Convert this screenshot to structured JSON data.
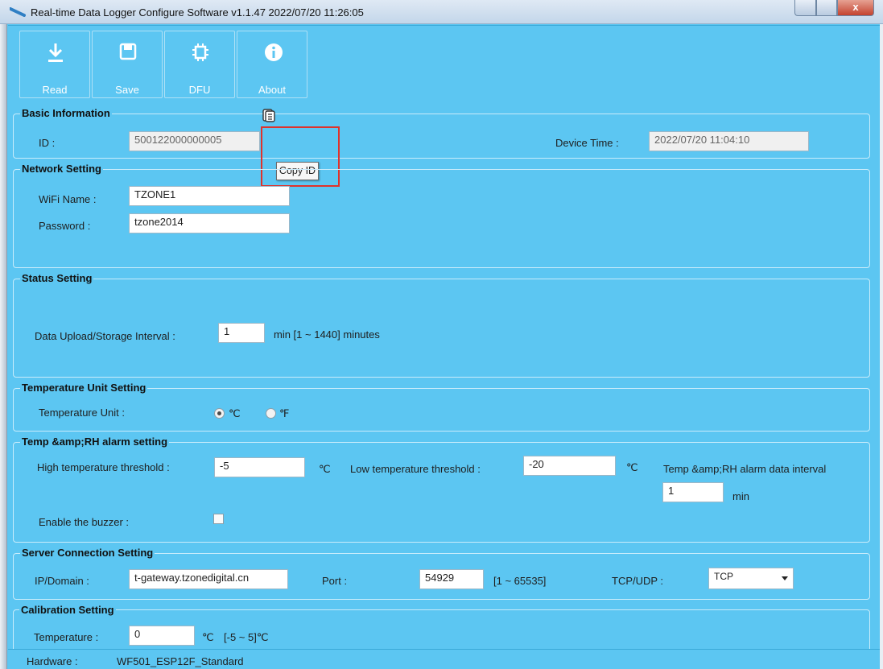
{
  "window": {
    "title": "Real-time Data Logger Configure Software v1.1.47  2022/07/20 11:26:05",
    "close_glyph": "x"
  },
  "toolbar": {
    "read_label": "Read",
    "save_label": "Save",
    "dfu_label": "DFU",
    "about_label": "About"
  },
  "basic_info": {
    "title": "Basic Information",
    "id_label": "ID :",
    "id_value": "500122000000005",
    "copy_tooltip": "Copy ID",
    "device_time_label": "Device Time :",
    "device_time_value": "2022/07/20 11:04:10"
  },
  "network": {
    "title": "Network Setting",
    "wifi_label": "WiFi Name :",
    "wifi_value": "TZONE1",
    "password_label": "Password :",
    "password_value": "tzone2014"
  },
  "status": {
    "title": "Status Setting",
    "interval_label": "Data Upload/Storage Interval :",
    "interval_value": "1",
    "interval_unit": "min  [1 ~ 1440] minutes"
  },
  "temp_unit": {
    "title": "Temperature Unit Setting",
    "label": "Temperature Unit :",
    "option_c": "℃",
    "option_f": "℉",
    "selected": "℃"
  },
  "alarm": {
    "title": "Temp &amp;RH alarm setting",
    "high_label": "High temperature threshold :",
    "high_value": "-5",
    "high_unit": "℃",
    "low_label": "Low temperature threshold :",
    "low_value": "-20",
    "low_unit": "℃",
    "interval_label": "Temp &amp;RH alarm data interval",
    "interval_value": "1",
    "interval_unit": "min",
    "buzzer_label": "Enable the buzzer :",
    "buzzer_checked": false
  },
  "server": {
    "title": "Server Connection Setting",
    "domain_label": "IP/Domain :",
    "domain_value": "t-gateway.tzonedigital.cn",
    "port_label": "Port :",
    "port_value": "54929",
    "port_range": "[1 ~ 65535]",
    "protocol_label": "TCP/UDP :",
    "protocol_value": "TCP"
  },
  "calibration": {
    "title": "Calibration Setting",
    "temp_label": "Temperature :",
    "temp_value": "0",
    "temp_unit": "℃",
    "temp_range": "[-5 ~ 5]℃"
  },
  "statusbar": {
    "hardware_label": "Hardware :",
    "hardware_value": "WF501_ESP12F_Standard"
  },
  "colors": {
    "background": "#5cc6f2",
    "highlight": "#e0322b"
  }
}
